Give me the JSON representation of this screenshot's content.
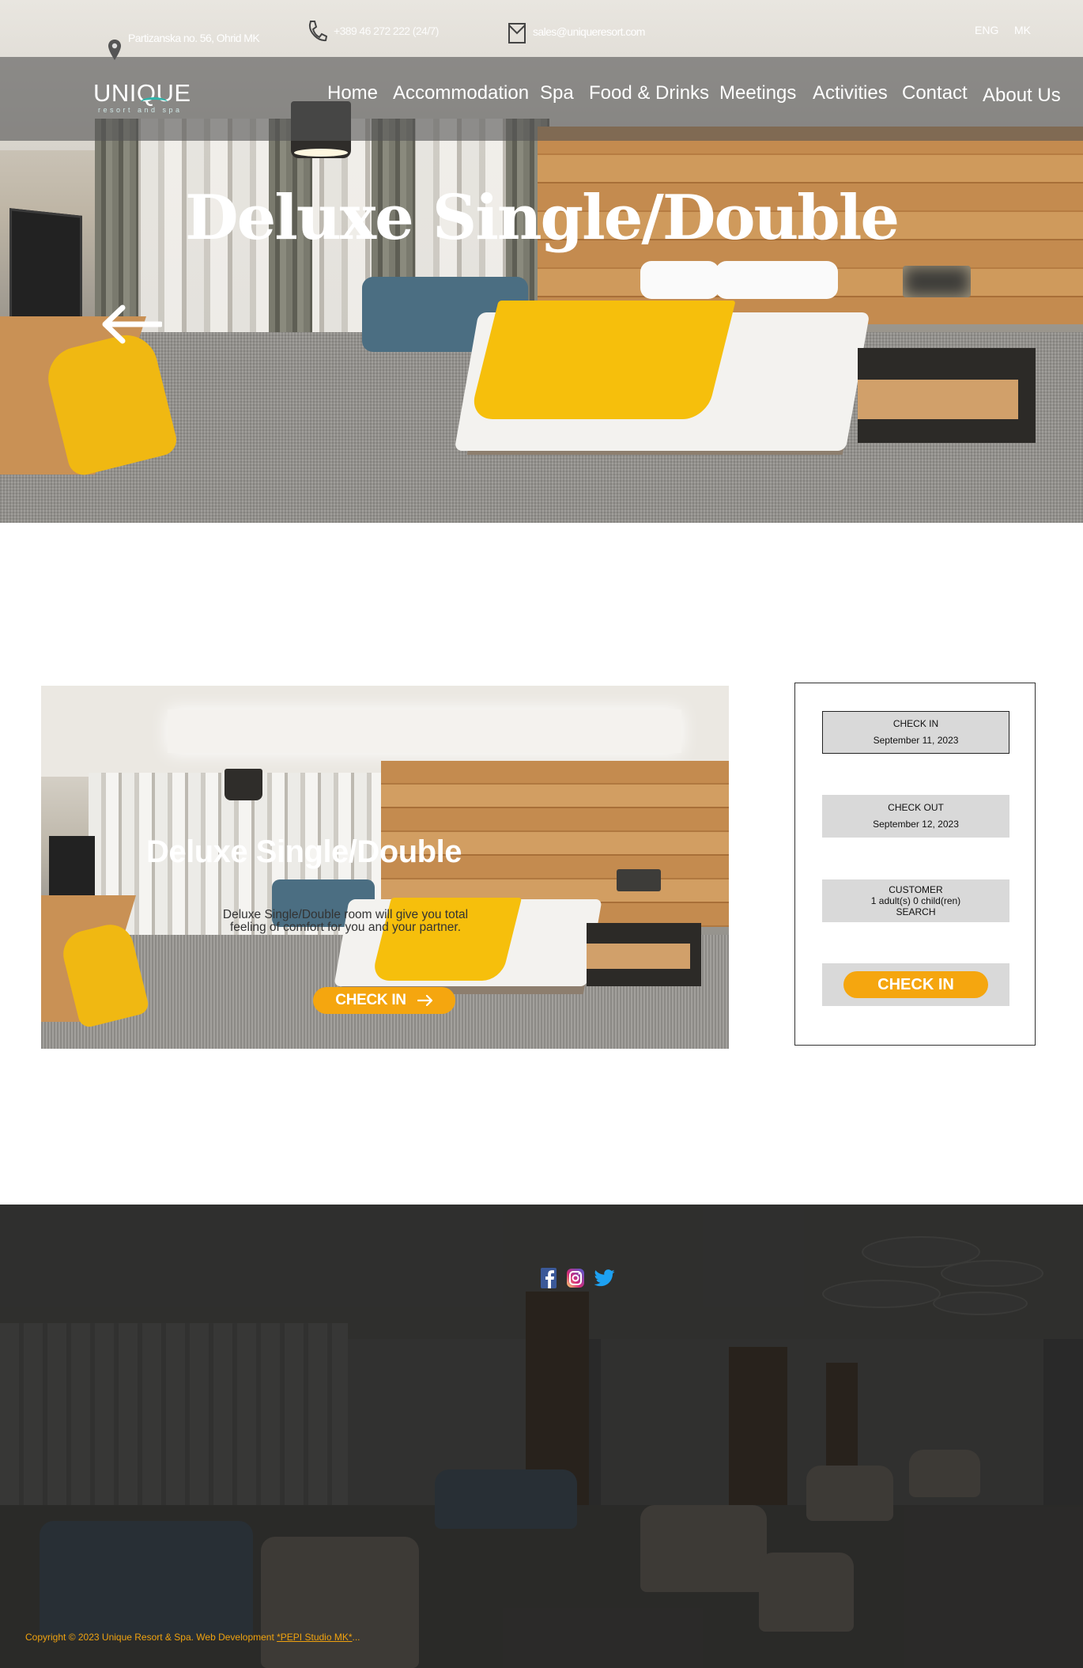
{
  "topbar": {
    "address": "Partizanska no. 56, Ohrid MK",
    "phone": "+389 46 272 222 (24/7)",
    "email": "sales@uniqueresort.com",
    "languages": [
      "ENG",
      "MK"
    ]
  },
  "logo": {
    "name": "UNIQUE",
    "tagline": "resort and spa"
  },
  "nav": {
    "items": [
      "Home",
      "Accommodation",
      "Spa",
      "Food & Drinks",
      "Meetings",
      "Activities",
      "Contact",
      "About Us"
    ]
  },
  "hero": {
    "title": "Deluxe Single/Double",
    "back_icon": "arrow-left-icon"
  },
  "room_card": {
    "title": "Deluxe Single/Double",
    "description": "Deluxe Single/Double room will give you total feeling of comfort for you and your partner.",
    "button_label": "CHECK IN",
    "button_icon": "arrow-right-icon"
  },
  "booking": {
    "check_in_label": "CHECK IN",
    "check_in_value": "September 11, 2023",
    "check_out_label": "CHECK OUT",
    "check_out_value": "September 12, 2023",
    "customer_label": "CUSTOMER",
    "customer_value": "1 adult(s) 0 child(ren)",
    "search_label": "SEARCH",
    "submit_label": "CHECK IN"
  },
  "footer": {
    "social": [
      "facebook-icon",
      "instagram-icon",
      "twitter-icon"
    ],
    "copyright_text": "Copyright © 2023 Unique Resort & Spa. Web Development ",
    "developer_link": "*PEPI Studio MK*",
    "ellipsis": "..."
  },
  "colors": {
    "accent": "#f5a60f",
    "nav_overlay": "#555555",
    "footer_text": "#f0a20e"
  }
}
